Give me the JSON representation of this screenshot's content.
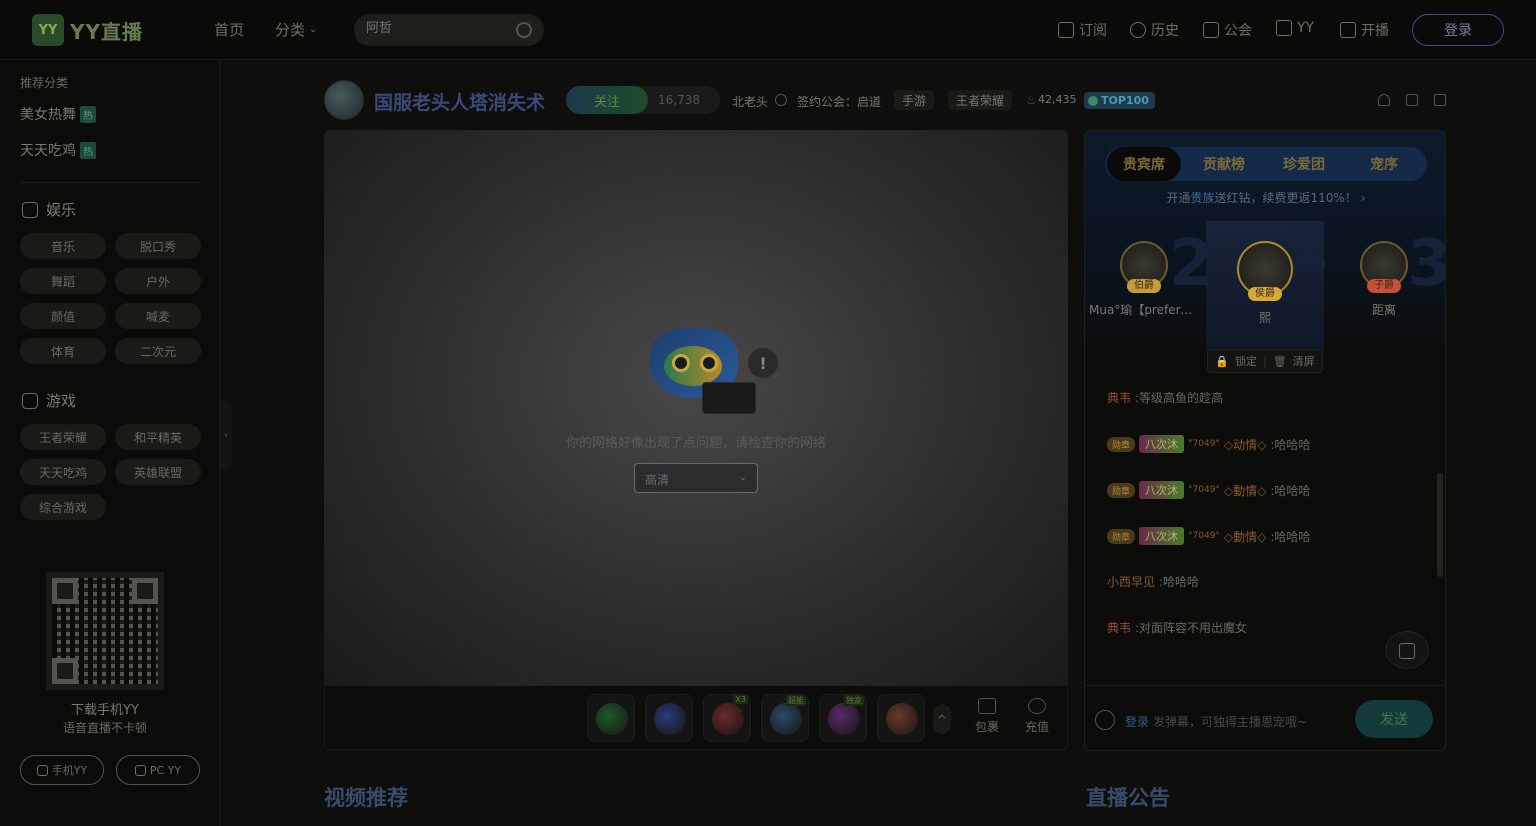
{
  "header": {
    "logo_badge": "YY",
    "logo_text": "YY直播",
    "nav": [
      "首页",
      "分类"
    ],
    "search_placeholder": "阿哲",
    "right_items": [
      "订阅",
      "历史",
      "公会",
      "YY",
      "开播"
    ],
    "login_label": "登录"
  },
  "sidebar": {
    "recommend_title": "推荐分类",
    "hot_items": [
      {
        "label": "美女热舞",
        "tag": "热"
      },
      {
        "label": "天天吃鸡",
        "tag": "热"
      }
    ],
    "entertainment": {
      "title": "娱乐",
      "chips": [
        "音乐",
        "脱口秀",
        "舞蹈",
        "户外",
        "颜值",
        "喊麦",
        "体育",
        "二次元"
      ]
    },
    "games": {
      "title": "游戏",
      "chips": [
        "王者荣耀",
        "和平精英",
        "天天吃鸡",
        "英雄联盟",
        "综合游戏"
      ]
    },
    "download_title": "下载手机YY",
    "download_sub": "语音直播不卡顿",
    "buttons": [
      "手机YY",
      "PC YY"
    ],
    "collapse_icon": "‹"
  },
  "room": {
    "title": "国服老头人塔消失术",
    "follow_label": "关注",
    "follow_count": "16,738",
    "streamer_name": "北老头",
    "guild_text": "签约公会：启道",
    "tags": [
      "手游",
      "王者荣耀"
    ],
    "heat": "42,435",
    "rank_badge": "TOP100"
  },
  "player": {
    "error_message": "你的网络好像出现了点问题，请检查你的网络",
    "quality_label": "高清",
    "quality_chevron": "⌄",
    "bubble": "!",
    "gifts": [
      {
        "name": "gift-1",
        "color": "#1f5a2a",
        "badge": ""
      },
      {
        "name": "gift-2",
        "color": "#2a3a7a",
        "badge": ""
      },
      {
        "name": "gift-3",
        "color": "#6a2a2a",
        "badge": "X3"
      },
      {
        "name": "gift-4",
        "color": "#2a4a6a",
        "badge": "超能"
      },
      {
        "name": "gift-5",
        "color": "#5a2a6a",
        "badge": "独家"
      },
      {
        "name": "gift-6",
        "color": "#6a3a2a",
        "badge": ""
      }
    ],
    "more_icon": "^",
    "actions": [
      "包裹",
      "充值"
    ]
  },
  "panel": {
    "tabs": [
      "贵宾席",
      "贡献榜",
      "珍爱团",
      "宠序"
    ],
    "promo_prefix": "开通",
    "promo_highlight": "贵族",
    "promo_suffix": "送红钻，续费更返110%！",
    "rank_numbers": [
      "2",
      "1",
      "3"
    ],
    "ranks": [
      {
        "name": "Mua°瑜【prefere...",
        "badge": "伯爵",
        "badge_color": "#c89a3a"
      },
      {
        "name": "熙",
        "badge": "侯爵",
        "badge_color": "#d8a83a"
      },
      {
        "name": "距离",
        "badge": "子爵",
        "badge_color": "#c8503a"
      }
    ],
    "lock_label": "锁定",
    "clear_label": "清屏",
    "chat": [
      {
        "nick": "典韦",
        "text": ":等级高鱼的趁高",
        "badge": false
      },
      {
        "nick": "◇动情◇",
        "text": ":哈哈哈",
        "badge": true,
        "fan": "八次沐",
        "num": "°7049°"
      },
      {
        "nick": "◇動情◇",
        "text": ":哈哈哈",
        "badge": true,
        "fan": "八次沐",
        "num": "°7049°"
      },
      {
        "nick": "◇動情◇",
        "text": ":哈哈哈",
        "badge": true,
        "fan": "八次沐",
        "num": "°7049°"
      },
      {
        "nick": "小西早见",
        "text": ":哈哈哈",
        "badge": false
      },
      {
        "nick": "典韦",
        "text": ":对面阵容不用出魔女",
        "badge": false
      }
    ],
    "level_label": "勋章",
    "input_login": "登录",
    "input_placeholder": "发弹幕，可独得主播恩宠哦~",
    "send_label": "发送"
  },
  "sections": [
    "视频推荐",
    "直播公告"
  ]
}
